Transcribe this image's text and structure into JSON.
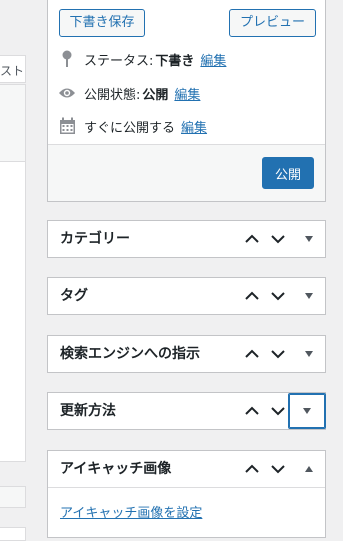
{
  "editor": {
    "tab_label": "スト"
  },
  "publish": {
    "save_draft_label": "下書き保存",
    "preview_label": "プレビュー",
    "status": {
      "label": "ステータス:",
      "value": "下書き",
      "edit": "編集"
    },
    "visibility": {
      "label": "公開状態:",
      "value": "公開",
      "edit": "編集"
    },
    "schedule": {
      "label": "すぐに公開する",
      "edit": "編集"
    },
    "publish_label": "公開"
  },
  "postboxes": [
    {
      "title": "カテゴリー"
    },
    {
      "title": "タグ"
    },
    {
      "title": "検索エンジンへの指示"
    },
    {
      "title": "更新方法"
    },
    {
      "title": "アイキャッチ画像",
      "link": "アイキャッチ画像を設定"
    }
  ],
  "colors": {
    "accent": "#2271b1",
    "background": "#f0f0f1",
    "border": "#c3c4c7",
    "icon": "#8c8f94"
  }
}
